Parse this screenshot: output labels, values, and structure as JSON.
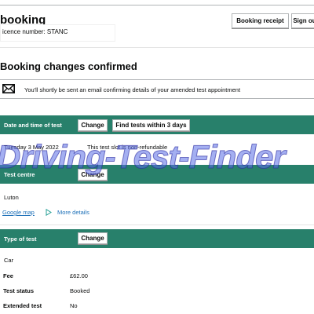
{
  "header": {
    "title": "booking",
    "licence_label": "icence number: STANC",
    "buttons": {
      "booking_receipt": "Booking receipt",
      "sign_out": "Sign ou"
    }
  },
  "confirmation": {
    "heading": "Booking changes confirmed",
    "notice": "You'll shortly be sent an email confirming details of your amended test appointment"
  },
  "sections": {
    "date_time": {
      "label": "Date and time of test",
      "change_label": "Change",
      "find_label": "Find tests within 3 days",
      "date_value": "Tuesday 3 May 2022",
      "refund_note": "This test slot is non-refundable"
    },
    "centre": {
      "label": "Test centre",
      "change_label": "Change",
      "name": "Luton",
      "map_link": "Google map",
      "more_details": "More details"
    },
    "type": {
      "label": "Type of test",
      "change_label": "Change",
      "value": "Car",
      "rows": [
        {
          "label": "Fee",
          "value": "£62.00"
        },
        {
          "label": "Test status",
          "value": "Booked"
        },
        {
          "label": "Extended test",
          "value": "No"
        }
      ]
    }
  },
  "watermark": "Driving-Test-Finder",
  "colors": {
    "bar": "#28806b",
    "link": "#1d70b8",
    "text": "#0b0c0c"
  }
}
